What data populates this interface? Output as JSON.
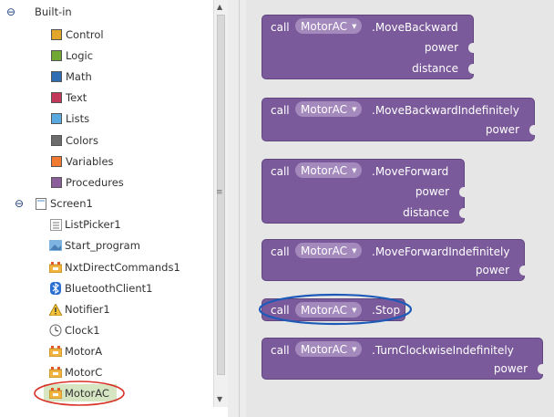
{
  "palette": {
    "builtin": {
      "label": "Built-in",
      "toggle": "⊖"
    },
    "builtin_items": [
      {
        "label": "Control",
        "color": "#e1a62a"
      },
      {
        "label": "Logic",
        "color": "#71a834"
      },
      {
        "label": "Math",
        "color": "#2e6db3"
      },
      {
        "label": "Text",
        "color": "#c2385a"
      },
      {
        "label": "Lists",
        "color": "#5aa9e0"
      },
      {
        "label": "Colors",
        "color": "#6c6c6c"
      },
      {
        "label": "Variables",
        "color": "#f07a32"
      },
      {
        "label": "Procedures",
        "color": "#8b5f9c"
      }
    ],
    "screen": {
      "label": "Screen1",
      "toggle": "⊖"
    },
    "components": [
      {
        "label": "ListPicker1",
        "icon": "list-picker-icon"
      },
      {
        "label": "Start_program",
        "icon": "image-icon"
      },
      {
        "label": "NxtDirectCommands1",
        "icon": "lego-icon"
      },
      {
        "label": "BluetoothClient1",
        "icon": "bluetooth-icon"
      },
      {
        "label": "Notifier1",
        "icon": "warning-icon"
      },
      {
        "label": "Clock1",
        "icon": "clock-icon"
      },
      {
        "label": "MotorA",
        "icon": "lego-icon"
      },
      {
        "label": "MotorC",
        "icon": "lego-icon"
      },
      {
        "label": "MotorAC",
        "icon": "lego-icon"
      }
    ],
    "highlight_color": "#d9332a",
    "selected_bg": "#d6e5c2"
  },
  "blocks": [
    {
      "call": "call",
      "component": "MotorAC",
      "method": ".MoveBackward",
      "params": [
        "power",
        "distance"
      ]
    },
    {
      "call": "call",
      "component": "MotorAC",
      "method": ".MoveBackwardIndefinitely",
      "params": [
        "power"
      ]
    },
    {
      "call": "call",
      "component": "MotorAC",
      "method": ".MoveForward",
      "params": [
        "power",
        "distance"
      ]
    },
    {
      "call": "call",
      "component": "MotorAC",
      "method": ".MoveForwardIndefinitely",
      "params": [
        "power"
      ]
    },
    {
      "call": "call",
      "component": "MotorAC",
      "method": ".Stop",
      "params": []
    },
    {
      "call": "call",
      "component": "MotorAC",
      "method": ".TurnClockwiseIndefinitely",
      "params": [
        "power"
      ]
    }
  ],
  "block_color": "#7b5a9c",
  "stop_highlight_color": "#1e5bb8"
}
